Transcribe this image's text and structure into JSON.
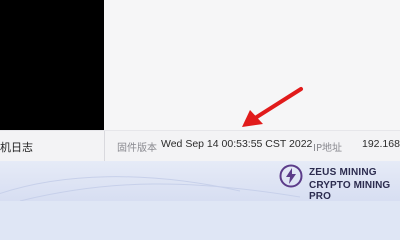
{
  "sidebar": {
    "active_item_label": "机日志"
  },
  "status_bar": {
    "firmware_label": "固件版本",
    "firmware_value": "Wed Sep 14 00:53:55 CST 2022",
    "ip_label": "IP地址",
    "ip_value": "192.168."
  },
  "watermark": {
    "line1": "ZEUS MINING",
    "line2": "CRYPTO MINING PRO",
    "icon": "lightning-circle-icon"
  },
  "annotation": {
    "icon": "red-arrow-icon",
    "color": "#e11b1b"
  }
}
